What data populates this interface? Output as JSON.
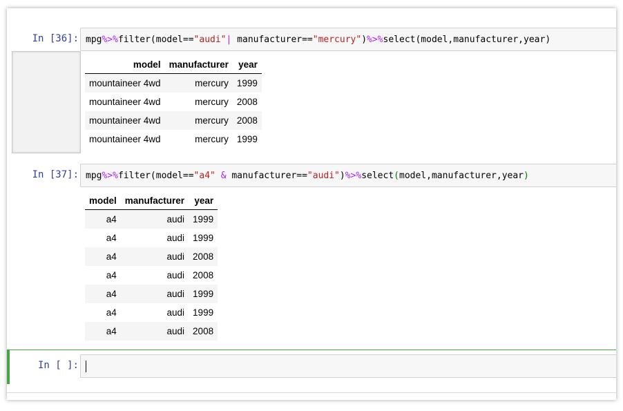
{
  "cells": [
    {
      "prompt": "In  [36]:",
      "code": {
        "p1": "mpg",
        "op1": "%>%",
        "p2": "filter(model==",
        "s1": "\"audi\"",
        "sep": "| ",
        "p3": "manufacturer==",
        "s2": "\"mercury\"",
        "p4": ")",
        "op2": "%>%",
        "p5": "select(model,manufacturer,year)"
      },
      "table": {
        "headers": [
          "model",
          "manufacturer",
          "year"
        ],
        "rows": [
          [
            "mountaineer 4wd",
            "mercury",
            "1999"
          ],
          [
            "mountaineer 4wd",
            "mercury",
            "2008"
          ],
          [
            "mountaineer 4wd",
            "mercury",
            "2008"
          ],
          [
            "mountaineer 4wd",
            "mercury",
            "1999"
          ]
        ]
      }
    },
    {
      "prompt": "In  [37]:",
      "code": {
        "p1": "mpg",
        "op1": "%>%",
        "p2": "filter(model==",
        "s1": "\"a4\"",
        "amp": "&",
        "p3": "manufacturer==",
        "s2": "\"audi\"",
        "p4": ")",
        "op2": "%>%",
        "p5a": "select",
        "paren_open": "(",
        "p5b": "model,manufacturer,year",
        "paren_close": ")"
      },
      "table": {
        "headers": [
          "model",
          "manufacturer",
          "year"
        ],
        "rows": [
          [
            "a4",
            "audi",
            "1999"
          ],
          [
            "a4",
            "audi",
            "1999"
          ],
          [
            "a4",
            "audi",
            "2008"
          ],
          [
            "a4",
            "audi",
            "2008"
          ],
          [
            "a4",
            "audi",
            "1999"
          ],
          [
            "a4",
            "audi",
            "1999"
          ],
          [
            "a4",
            "audi",
            "2008"
          ]
        ]
      }
    },
    {
      "prompt": "In  [ ]:",
      "code": ""
    }
  ],
  "colors": {
    "prompt": "#303f9f",
    "operator": "#aa22ff",
    "string": "#ba2121",
    "active_border": "#42a642"
  }
}
